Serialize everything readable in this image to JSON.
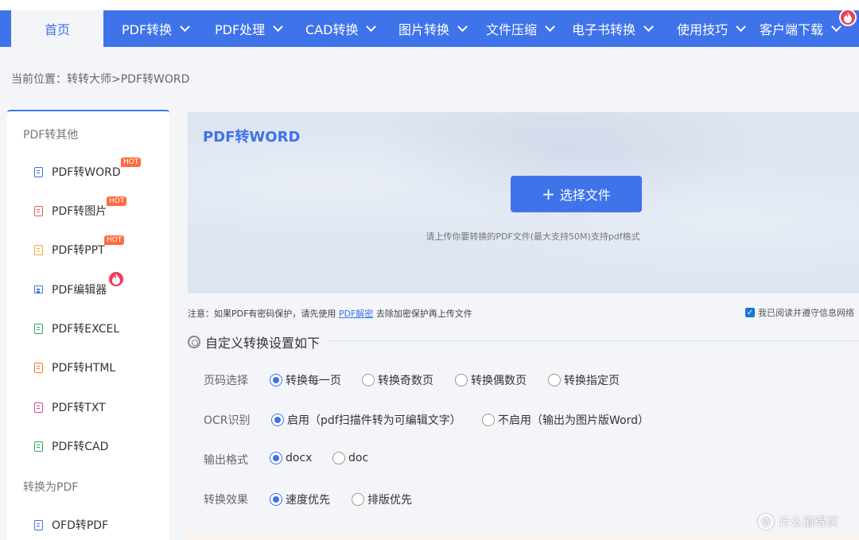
{
  "nav": {
    "home": "首页",
    "items": [
      {
        "label": "PDF转换"
      },
      {
        "label": "PDF处理"
      },
      {
        "label": "CAD转换"
      },
      {
        "label": "图片转换"
      },
      {
        "label": "文件压缩"
      },
      {
        "label": "电子书转换"
      },
      {
        "label": "使用技巧"
      },
      {
        "label": "客户端下载"
      }
    ]
  },
  "breadcrumb": "当前位置：转转大师>PDF转WORD",
  "sidebar": {
    "group1": "PDF转其他",
    "group2": "转换为PDF",
    "hot_badge": "HOT",
    "items": [
      {
        "label": "PDF转WORD",
        "color": "#3f73e9"
      },
      {
        "label": "PDF转图片",
        "color": "#f05050"
      },
      {
        "label": "PDF转PPT",
        "color": "#f5a623"
      },
      {
        "label": "PDF编辑器",
        "color": "#3f73e9"
      },
      {
        "label": "PDF转EXCEL",
        "color": "#27ae60"
      },
      {
        "label": "PDF转HTML",
        "color": "#f08030"
      },
      {
        "label": "PDF转TXT",
        "color": "#e84393"
      },
      {
        "label": "PDF转CAD",
        "color": "#27ae60"
      },
      {
        "label": "OFD转PDF",
        "color": "#3f73e9"
      }
    ]
  },
  "upload": {
    "title": "PDF转WORD",
    "button": "选择文件",
    "hint": "请上传你要转换的PDF文件(最大支持50M)支持pdf格式"
  },
  "note": {
    "prefix": "注意：如果PDF有密码保护，请先使用",
    "link": "PDF解密",
    "suffix": "去除加密保护再上传文件",
    "agree": "我已阅读并遵守信息网络"
  },
  "settings": {
    "title": "自定义转换设置如下",
    "rows": [
      {
        "label": "页码选择",
        "options": [
          "转换每一页",
          "转换奇数页",
          "转换偶数页",
          "转换指定页"
        ],
        "selected": 0
      },
      {
        "label": "OCR识别",
        "options": [
          "启用（pdf扫描件转为可编辑文字）",
          "不启用（输出为图片版Word）"
        ],
        "selected": 0
      },
      {
        "label": "输出格式",
        "options": [
          "docx",
          "doc"
        ],
        "selected": 0
      },
      {
        "label": "转换效果",
        "options": [
          "速度优先",
          "排版优先"
        ],
        "selected": 0
      }
    ]
  },
  "watermark": "什么值得买",
  "colors": {
    "accent": "#3f73e9",
    "hot": "#ff6b3d",
    "fire": "#f03a5f"
  }
}
